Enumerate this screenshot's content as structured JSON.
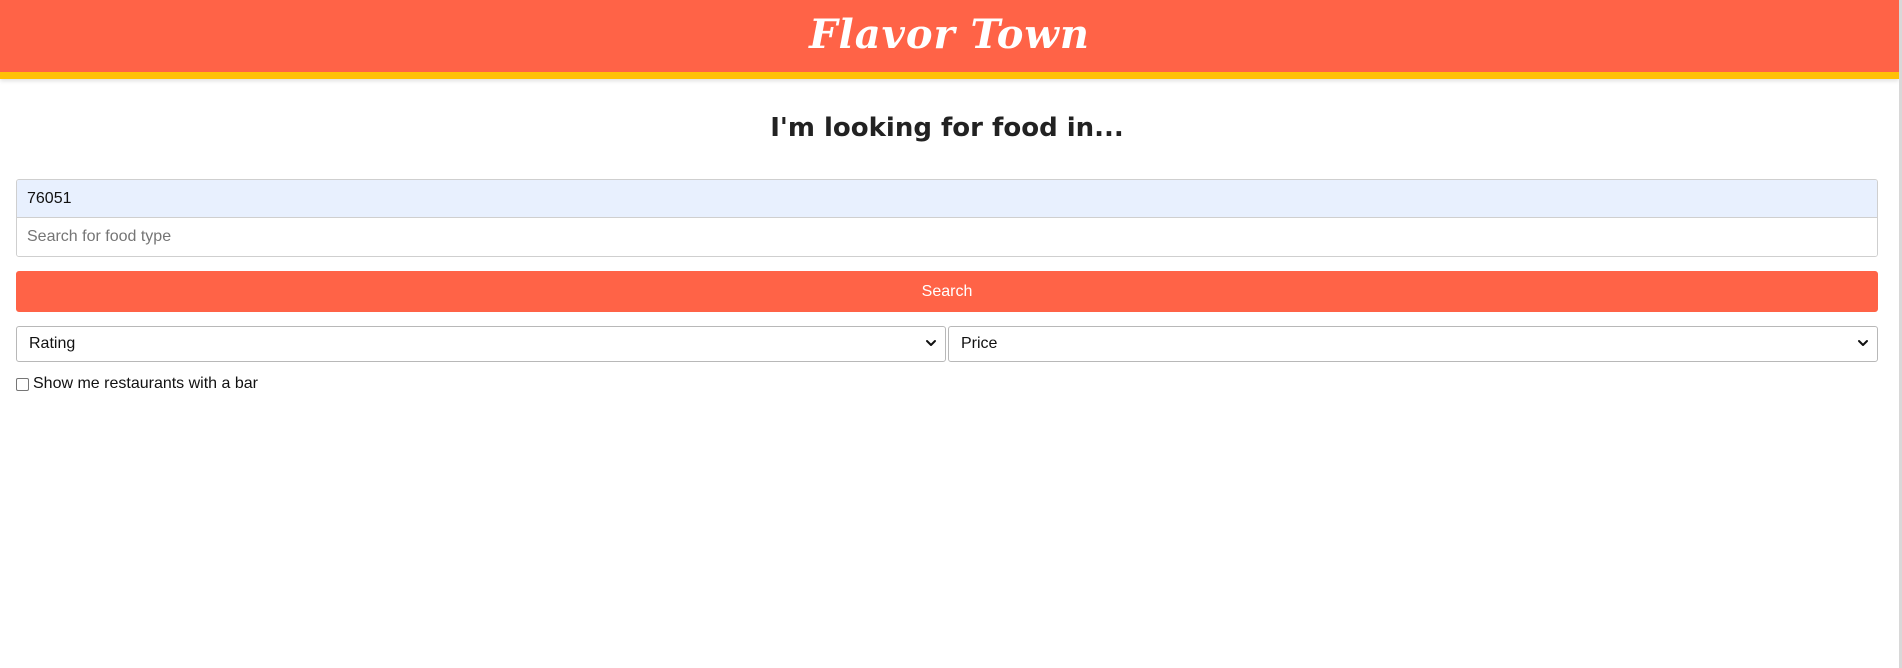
{
  "header": {
    "brand": "Flavor Town"
  },
  "main": {
    "heading": "I'm looking for food in...",
    "location_input": {
      "value": "76051",
      "placeholder": ""
    },
    "food_input": {
      "value": "",
      "placeholder": "Search for food type"
    },
    "search_button": "Search",
    "filters": {
      "rating_select": "Rating",
      "price_select": "Price"
    },
    "bar_checkbox": {
      "label": "Show me restaurants with a bar",
      "checked": false
    }
  },
  "colors": {
    "header_background": "#ff6347",
    "header_stripe": "#ffc107",
    "button_background": "#ff6347",
    "autofill_background": "#e8f0fe"
  },
  "icons": {
    "select_arrow": "chevron-down-icon"
  }
}
